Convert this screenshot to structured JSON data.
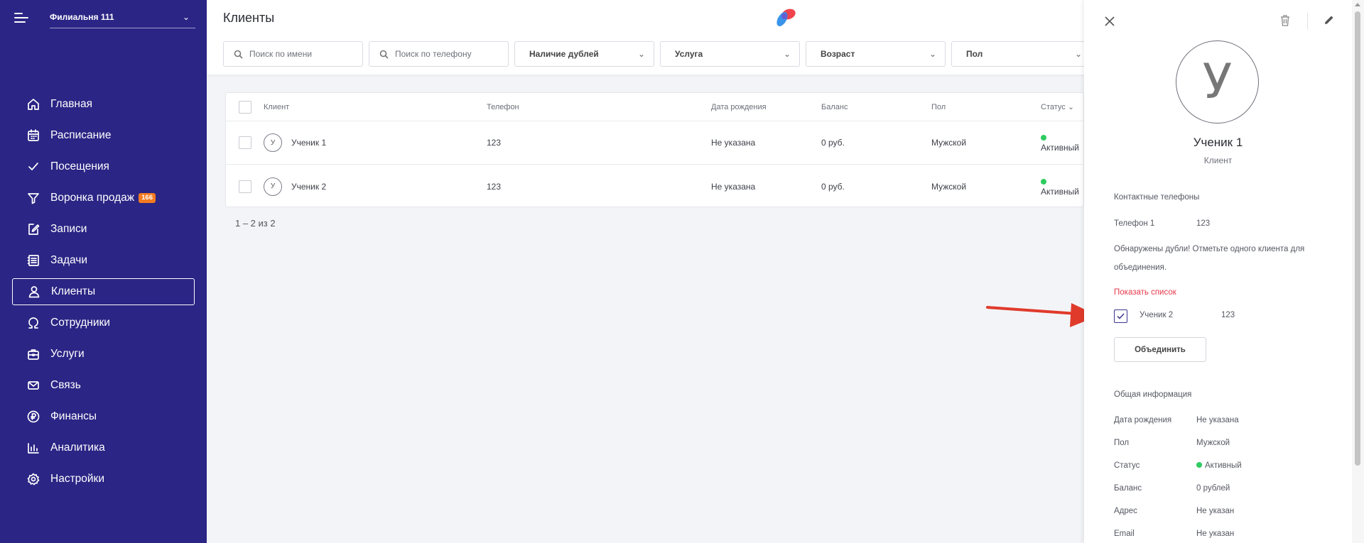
{
  "sidebar": {
    "branch": "Филиальня 111",
    "items": [
      {
        "label": "Главная",
        "icon": "home-icon"
      },
      {
        "label": "Расписание",
        "icon": "calendar-icon"
      },
      {
        "label": "Посещения",
        "icon": "checkmark-icon"
      },
      {
        "label": "Воронка продаж",
        "icon": "funnel-icon",
        "badge": "166"
      },
      {
        "label": "Записи",
        "icon": "edit-note-icon"
      },
      {
        "label": "Задачи",
        "icon": "task-list-icon"
      },
      {
        "label": "Клиенты",
        "icon": "user-icon",
        "active": true
      },
      {
        "label": "Сотрудники",
        "icon": "omega-icon"
      },
      {
        "label": "Услуги",
        "icon": "briefcase-icon"
      },
      {
        "label": "Связь",
        "icon": "mail-icon"
      },
      {
        "label": "Финансы",
        "icon": "ruble-icon"
      },
      {
        "label": "Аналитика",
        "icon": "bar-chart-icon"
      },
      {
        "label": "Настройки",
        "icon": "gear-icon"
      }
    ]
  },
  "header": {
    "title": "Клиенты",
    "filters": {
      "name_placeholder": "Поиск по имени",
      "phone_placeholder": "Поиск по телефону",
      "duplicates": "Наличие дублей",
      "service": "Услуга",
      "age": "Возраст",
      "gender": "Пол"
    }
  },
  "table": {
    "columns": {
      "client": "Клиент",
      "phone": "Телефон",
      "birth": "Дата рождения",
      "balance": "Баланс",
      "gender": "Пол",
      "status": "Статус"
    },
    "rows": [
      {
        "initial": "У",
        "name": "Ученик 1",
        "phone": "123",
        "birth": "Не указана",
        "balance": "0 руб.",
        "gender": "Мужской",
        "status": "Активный"
      },
      {
        "initial": "У",
        "name": "Ученик 2",
        "phone": "123",
        "birth": "Не указана",
        "balance": "0 руб.",
        "gender": "Мужской",
        "status": "Активный"
      }
    ],
    "pagination": "1 – 2 из 2"
  },
  "panel": {
    "avatar_initial": "У",
    "name": "Ученик 1",
    "role": "Клиент",
    "contacts_title": "Контактные телефоны",
    "phone_label": "Телефон 1",
    "phone_value": "123",
    "dup_line1": "Обнаружены дубли! Отметьте одного клиента для",
    "dup_line2": "объединения.",
    "show_list": "Показать список",
    "dup_name": "Ученик 2",
    "dup_phone": "123",
    "merge_label": "Объединить",
    "general_title": "Общая информация",
    "info": [
      {
        "label": "Дата рождения",
        "value": "Не указана"
      },
      {
        "label": "Пол",
        "value": "Мужской"
      },
      {
        "label": "Статус",
        "value": "Активный"
      },
      {
        "label": "Баланс",
        "value": "0 рублей"
      },
      {
        "label": "Адрес",
        "value": "Не указан"
      },
      {
        "label": "Email",
        "value": "Не указан"
      }
    ]
  },
  "colors": {
    "sidebar_bg": "#2b2585",
    "badge": "#f47b20",
    "active_status": "#2ecc5f",
    "link_red": "#e8394b",
    "arrow_red": "#e03a2b"
  }
}
